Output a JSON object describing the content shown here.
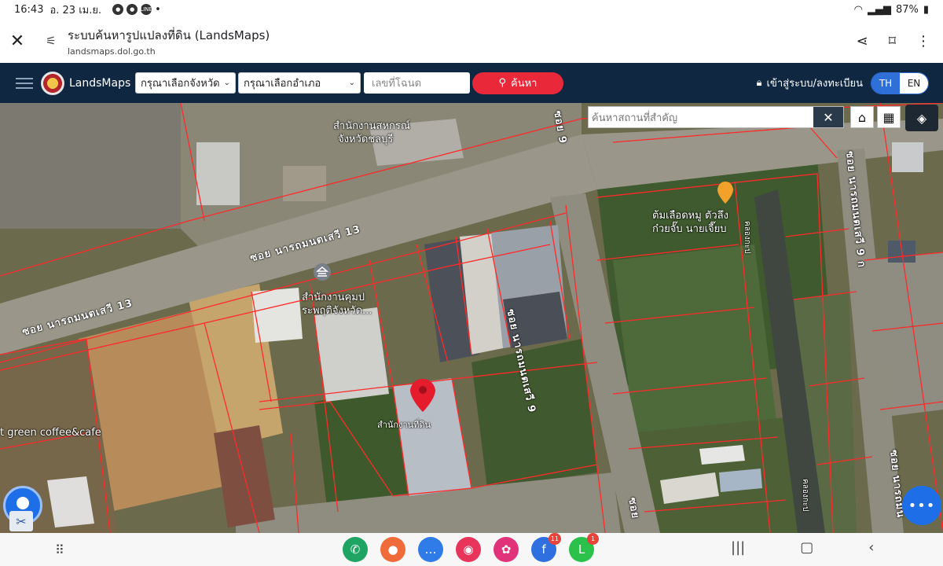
{
  "status": {
    "time": "16:43",
    "date": "อ. 23 เม.ย.",
    "notification_dots": [
      "●",
      "●",
      "LINE"
    ],
    "extra_dot": "•",
    "battery": "87%"
  },
  "browser": {
    "title": "ระบบค้นหารูปแปลงที่ดิน (LandsMaps)",
    "url": "landsmaps.dol.go.th"
  },
  "nav": {
    "brand": "LandsMaps",
    "province_placeholder": "กรุณาเลือกจังหวัด",
    "district_placeholder": "กรุณาเลือกอำเภอ",
    "deed_placeholder": "เลขที่โฉนด",
    "search_label": "ค้นหา",
    "login_label": "เข้าสู่ระบบ/ลงทะเบียน",
    "lang_th": "TH",
    "lang_en": "EN"
  },
  "map": {
    "place_search_placeholder": "ค้นหาสถานที่สำคัญ",
    "labels": {
      "cooperative_line1": "สำนักงานสหกรณ์",
      "cooperative_line2": "จังหวัดชลบุรี",
      "office_line1": "สำนักงานคุมป",
      "office_line2": "ระพฤติจังหวัด...",
      "noodle_line1": "ต้มเลือดหมู ตัวลึง",
      "noodle_line2": "ก๋วยจั๊บ นายเจี๊ยบ",
      "coffee": "t green coffee&cafe",
      "land_office": "สำนักงานที่ดิน",
      "canal_top": "คลองกะป",
      "canal_bottom": "คลองกะป"
    },
    "roads": {
      "soi13_a": "ซอย นารถมนตเสวี 13",
      "soi13_b": "ซอย นารถมนตเสวี 13",
      "soi9_mid": "ซอย นารถมนตเสวี 9",
      "soi9_top": "ซอย 9",
      "soi9_right": "ซอย นารถมนตเสวี 9 ก",
      "soi_bottom": "ซอย",
      "soi_br": "ซอย นารถมน"
    }
  },
  "dock": {
    "apps": [
      {
        "name": "phone",
        "color": "#1fa463",
        "glyph": "✆"
      },
      {
        "name": "contacts",
        "color": "#f06b3a",
        "glyph": "●"
      },
      {
        "name": "messages",
        "color": "#2f7be8",
        "glyph": "…"
      },
      {
        "name": "camera",
        "color": "#e8335a",
        "glyph": "◉"
      },
      {
        "name": "blossom",
        "color": "#e0337a",
        "glyph": "✿"
      },
      {
        "name": "facebook",
        "color": "#2f6fe0",
        "glyph": "f",
        "badge": "11"
      },
      {
        "name": "line",
        "color": "#2cc14b",
        "glyph": "L",
        "badge": "1"
      }
    ]
  }
}
